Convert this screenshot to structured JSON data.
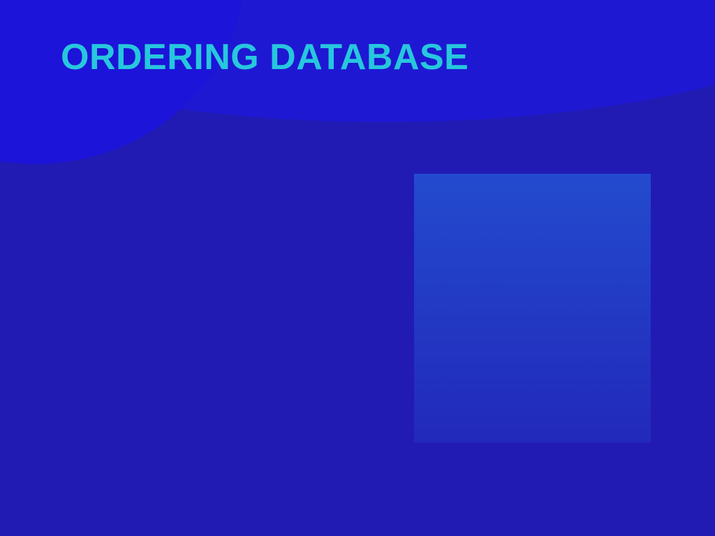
{
  "slide": {
    "title": "ORDERING DATABASE"
  },
  "colors": {
    "background": "#211bb4",
    "header_band": "#1e18d3",
    "title_text": "#27c7dd",
    "panel_top": "#234bce",
    "panel_bottom": "#2229bb"
  }
}
